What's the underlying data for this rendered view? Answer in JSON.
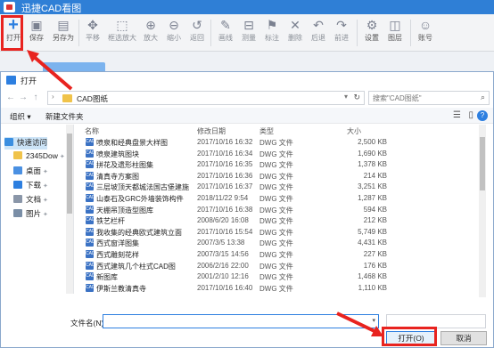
{
  "app": {
    "title": "迅捷CAD看图"
  },
  "toolbar": {
    "buttons": [
      {
        "id": "open",
        "label": "打开",
        "icon": "plus-icon"
      },
      {
        "id": "save",
        "label": "保存",
        "icon": "save-icon"
      },
      {
        "id": "saveas",
        "label": "另存为",
        "icon": "save-as-icon"
      },
      {
        "id": "pan",
        "label": "平移",
        "icon": "pan-icon"
      },
      {
        "id": "zoombox",
        "label": "框选放大",
        "icon": "zoom-box-icon"
      },
      {
        "id": "zoomin",
        "label": "放大",
        "icon": "zoom-in-icon"
      },
      {
        "id": "zoomout",
        "label": "缩小",
        "icon": "zoom-out-icon"
      },
      {
        "id": "back",
        "label": "返回",
        "icon": "back-icon"
      },
      {
        "id": "draw",
        "label": "画线",
        "icon": "pen-icon"
      },
      {
        "id": "measure",
        "label": "测量",
        "icon": "ruler-icon"
      },
      {
        "id": "annotate",
        "label": "标注",
        "icon": "annotate-icon"
      },
      {
        "id": "delete",
        "label": "删除",
        "icon": "delete-icon"
      },
      {
        "id": "undo",
        "label": "后退",
        "icon": "undo-icon"
      },
      {
        "id": "redo",
        "label": "前进",
        "icon": "redo-icon"
      },
      {
        "id": "settings",
        "label": "设置",
        "icon": "gear-icon"
      },
      {
        "id": "layers",
        "label": "图层",
        "icon": "layers-icon"
      },
      {
        "id": "account",
        "label": "账号",
        "icon": "user-icon"
      }
    ]
  },
  "dialog": {
    "title": "打开",
    "path": "CAD图纸",
    "search_placeholder": "搜索\"CAD图纸\"",
    "organize_label": "组织 ▾",
    "new_folder_label": "新建文件夹",
    "columns": {
      "name": "名称",
      "date": "修改日期",
      "type": "类型",
      "size": "大小"
    },
    "nav": [
      {
        "label": "快速访问",
        "color": "#3b8fe0",
        "pin": false
      },
      {
        "label": "2345Dow",
        "color": "#f0c34a",
        "pin": true
      },
      {
        "label": "桌面",
        "color": "#4a90e2",
        "pin": true
      },
      {
        "label": "下载",
        "color": "#2d7fe0",
        "pin": true
      },
      {
        "label": "文档",
        "color": "#8a96a8",
        "pin": true
      },
      {
        "label": "图片",
        "color": "#7a8ea6",
        "pin": true
      }
    ],
    "files": [
      {
        "name": "喷泉和经典盘景大样图",
        "date": "2017/10/16 16:32",
        "type": "DWG 文件",
        "size": "2,500 KB"
      },
      {
        "name": "喷泉建筑图块",
        "date": "2017/10/16 16:34",
        "type": "DWG 文件",
        "size": "1,690 KB"
      },
      {
        "name": "拼花及遗形柱图集",
        "date": "2017/10/16 16:35",
        "type": "DWG 文件",
        "size": "1,378 KB"
      },
      {
        "name": "清真寺方案图",
        "date": "2017/10/16 16:36",
        "type": "DWG 文件",
        "size": "214 KB"
      },
      {
        "name": "三层坡顶天都城法国古堡建施",
        "date": "2017/10/16 16:37",
        "type": "DWG 文件",
        "size": "3,251 KB"
      },
      {
        "name": "山泰石及GRC外墙装饰构件",
        "date": "2018/11/22 9:54",
        "type": "DWG 文件",
        "size": "1,287 KB"
      },
      {
        "name": "天棚吊顶造型图库",
        "date": "2017/10/16 16:38",
        "type": "DWG 文件",
        "size": "594 KB"
      },
      {
        "name": "铁艺栏杆",
        "date": "2008/6/20 16:08",
        "type": "DWG 文件",
        "size": "212 KB"
      },
      {
        "name": "我收集的经典欧式建筑立面",
        "date": "2017/10/16 15:54",
        "type": "DWG 文件",
        "size": "5,749 KB"
      },
      {
        "name": "西式窗洋图集",
        "date": "2007/3/5 13:38",
        "type": "DWG 文件",
        "size": "4,431 KB"
      },
      {
        "name": "西式雕刻花样",
        "date": "2007/3/15 14:56",
        "type": "DWG 文件",
        "size": "227 KB"
      },
      {
        "name": "西式建筑几个柱式CAD图",
        "date": "2006/2/16 22:00",
        "type": "DWG 文件",
        "size": "176 KB"
      },
      {
        "name": "新图库",
        "date": "2001/2/10 12:16",
        "type": "DWG 文件",
        "size": "1,468 KB"
      },
      {
        "name": "伊斯兰教清真寺",
        "date": "2017/10/16 16:40",
        "type": "DWG 文件",
        "size": "1,110 KB"
      }
    ],
    "filename_label": "文件名(N):",
    "filename_value": "",
    "open_label": "打开(O)",
    "cancel_label": "取消"
  },
  "accent": "#2d7fe0",
  "annotation_color": "#e8231f"
}
